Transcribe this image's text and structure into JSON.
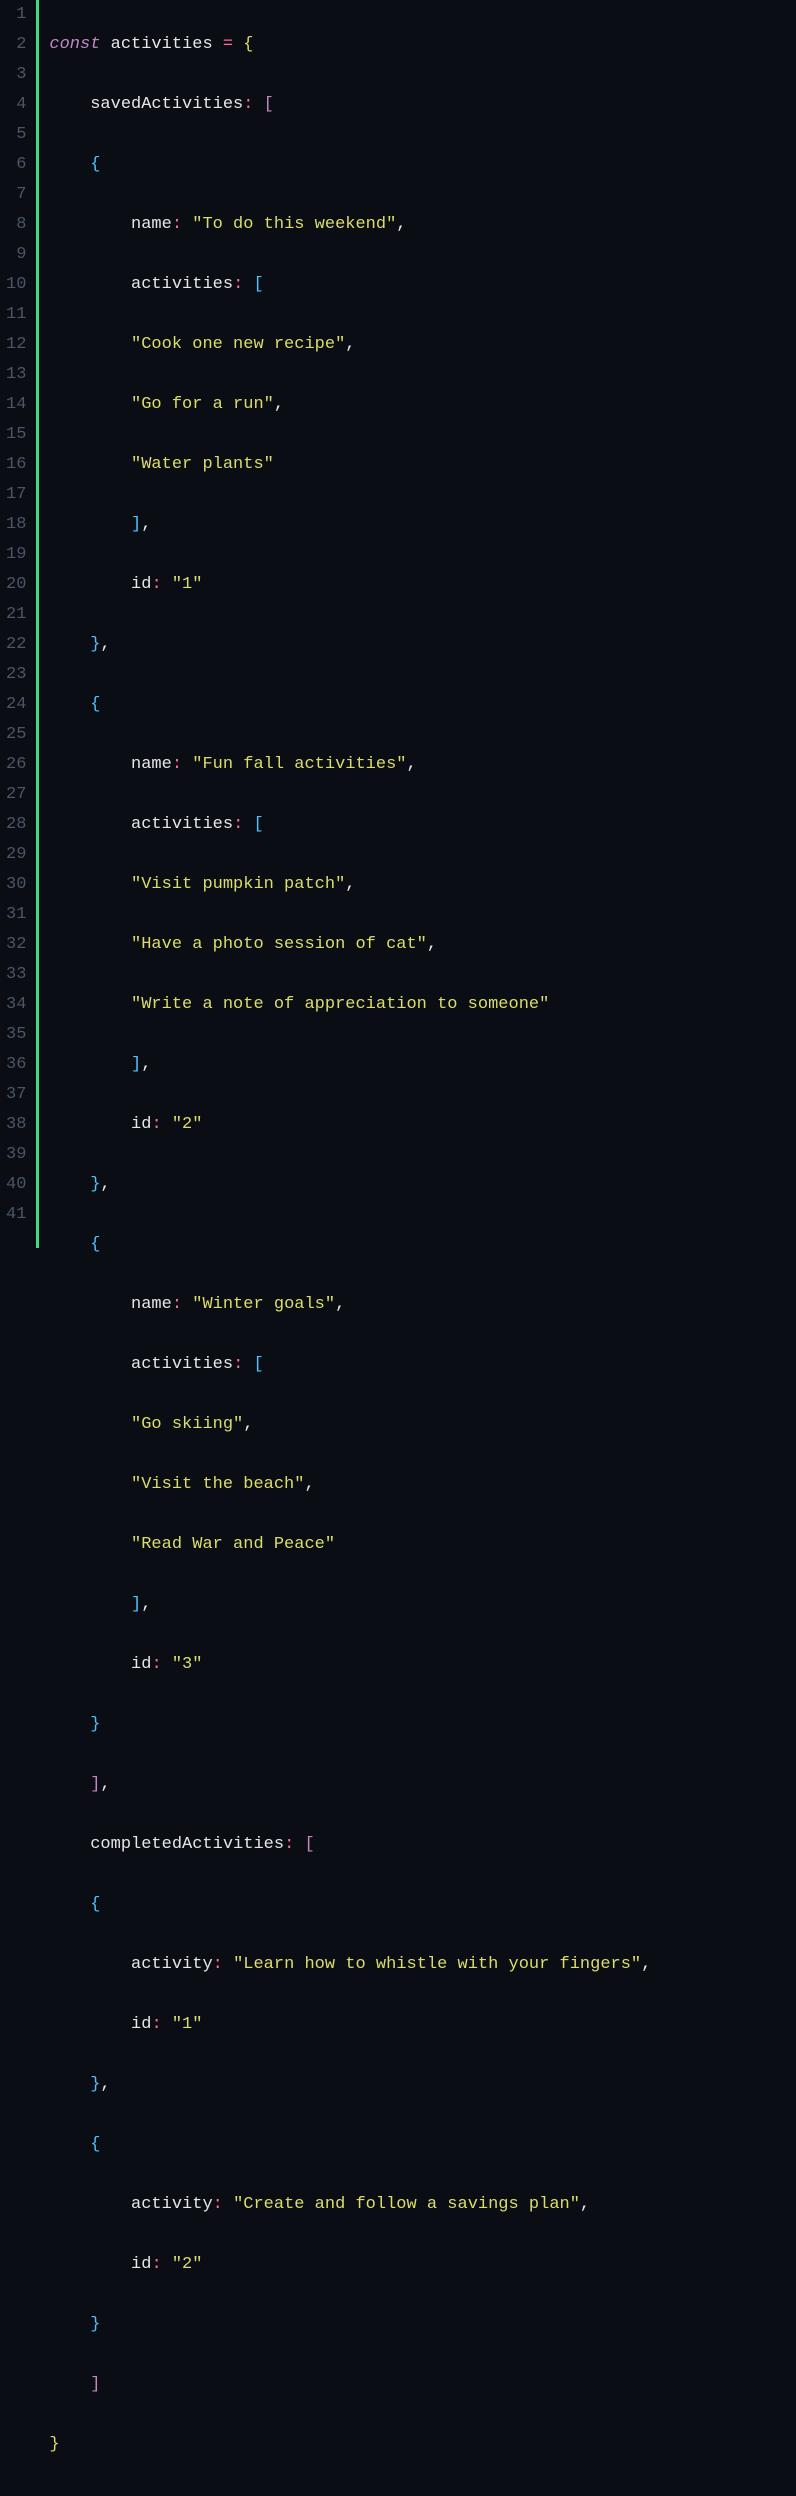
{
  "colors": {
    "background": "#0a0e14",
    "gutter_text": "#4a5568",
    "diff_added": "#3ddc84",
    "keyword": "#c586c0",
    "identifier": "#e6e6e6",
    "operator": "#ff6b9d",
    "brace_l1": "#dcdc6a",
    "brace_l2": "#4fc1ff",
    "bracket_l1": "#c586c0",
    "bracket_l2": "#4fc1ff",
    "string": "#dcdc6a"
  },
  "tokens": {
    "const": "const",
    "ident": "activities",
    "eq": "=",
    "colon": ":",
    "comma": ",",
    "lbrace": "{",
    "rbrace": "}",
    "lbracket": "[",
    "rbracket": "]",
    "prop_savedActivities": "savedActivities",
    "prop_completedActivities": "completedActivities",
    "prop_name": "name",
    "prop_activities": "activities",
    "prop_activity": "activity",
    "prop_id": "id"
  },
  "strings": {
    "s1_name": "\"To do this weekend\"",
    "s1_a0": "\"Cook one new recipe\"",
    "s1_a1": "\"Go for a run\"",
    "s1_a2": "\"Water plants\"",
    "s1_id": "\"1\"",
    "s2_name": "\"Fun fall activities\"",
    "s2_a0": "\"Visit pumpkin patch\"",
    "s2_a1": "\"Have a photo session of cat\"",
    "s2_a2": "\"Write a note of appreciation to someone\"",
    "s2_id": "\"2\"",
    "s3_name": "\"Winter goals\"",
    "s3_a0": "\"Go skiing\"",
    "s3_a1": "\"Visit the beach\"",
    "s3_a2": "\"Read War and Peace\"",
    "s3_id": "\"3\"",
    "c1_activity": "\"Learn how to whistle with your fingers\"",
    "c1_id": "\"1\"",
    "c2_activity": "\"Create and follow a savings plan\"",
    "c2_id": "\"2\""
  },
  "line_numbers": [
    "1",
    "2",
    "3",
    "4",
    "5",
    "6",
    "7",
    "8",
    "9",
    "10",
    "11",
    "12",
    "13",
    "14",
    "15",
    "16",
    "17",
    "18",
    "19",
    "20",
    "21",
    "22",
    "23",
    "24",
    "25",
    "26",
    "27",
    "28",
    "29",
    "30",
    "31",
    "32",
    "33",
    "34",
    "35",
    "36",
    "37",
    "38",
    "39",
    "40",
    "41"
  ]
}
